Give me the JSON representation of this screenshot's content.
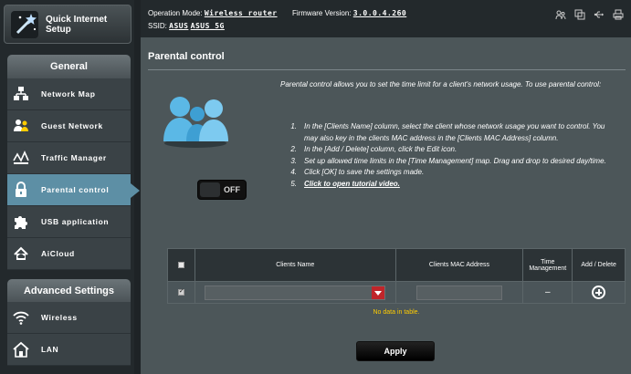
{
  "sidebar": {
    "quick_setup": {
      "label_line1": "Quick Internet",
      "label_line2": "Setup",
      "icon": "wand-icon"
    },
    "general_header": "General",
    "general_items": [
      {
        "label": "Network Map",
        "icon": "network-map-icon"
      },
      {
        "label": "Guest Network",
        "icon": "guest-network-icon"
      },
      {
        "label": "Traffic Manager",
        "icon": "traffic-manager-icon"
      },
      {
        "label": "Parental control",
        "icon": "lock-icon",
        "active": true
      },
      {
        "label": "USB application",
        "icon": "puzzle-icon"
      },
      {
        "label": "AiCloud",
        "icon": "cloud-home-icon"
      }
    ],
    "advanced_header": "Advanced Settings",
    "advanced_items": [
      {
        "label": "Wireless",
        "icon": "wifi-icon"
      },
      {
        "label": "LAN",
        "icon": "home-icon"
      }
    ]
  },
  "topbar": {
    "operation_mode_label": "Operation Mode:",
    "operation_mode_value": "Wireless router",
    "firmware_label": "Firmware Version:",
    "firmware_value": "3.0.0.4.260",
    "ssid_label": "SSID:",
    "ssid_1": "ASUS",
    "ssid_2": "ASUS_5G",
    "icons": [
      "users-icon",
      "copy-icon",
      "usb-icon",
      "printer-icon"
    ]
  },
  "main": {
    "title": "Parental control",
    "description": "Parental control allows you to set the time limit for a client's network usage. To use parental control:",
    "steps": [
      "In the [Clients Name] column, select the client whose network usage you want to control. You may also key in the clients MAC address in the [Clients MAC Address] column.",
      "In the [Add / Delete] column, click the Edit icon.",
      "Set up allowed time limits in the [Time Management] map. Drag and drop to desired day/time.",
      "Click [OK] to save the settings made.",
      "Click to open tutorial video."
    ],
    "step_numbers": [
      "1.",
      "2.",
      "3.",
      "4.",
      "5."
    ],
    "toggle_state": "OFF",
    "table": {
      "headers": {
        "clients_name": "Clients Name",
        "mac": "Clients MAC Address",
        "time_management": "Time Management",
        "add_delete": "Add / Delete"
      },
      "input_row": {
        "client_name": "",
        "mac": "",
        "time_management": "–"
      },
      "empty_text": "No data in table."
    },
    "apply_label": "Apply"
  },
  "colors": {
    "background": "#1e2326",
    "panel": "#4c5659",
    "active_item": "#5d8fa5",
    "empty_text": "#ffcc00",
    "dropdown_arrow": "#c0252a"
  }
}
